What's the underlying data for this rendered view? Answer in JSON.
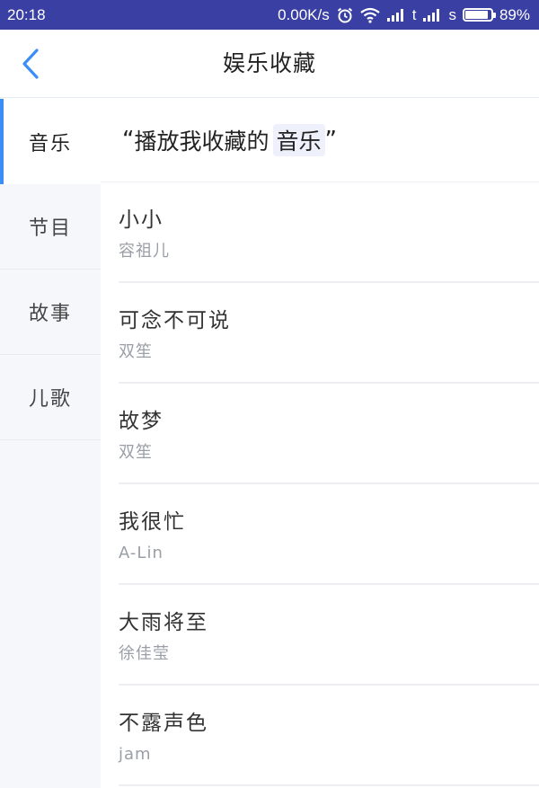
{
  "status_bar": {
    "time": "20:18",
    "speed": "0.00K/s",
    "carrier1": "t",
    "carrier2": "s",
    "battery_level": 0.89,
    "battery_text": "89%"
  },
  "header": {
    "title": "娱乐收藏",
    "back_icon": "chevron-left-icon",
    "accent_color": "#3a8ef6"
  },
  "sidebar": {
    "items": [
      {
        "label": "音乐",
        "active": true
      },
      {
        "label": "节目",
        "active": false
      },
      {
        "label": "故事",
        "active": false
      },
      {
        "label": "儿歌",
        "active": false
      }
    ]
  },
  "phrase": {
    "open_quote": "“",
    "prefix": "播放我收藏的",
    "keyword": "音乐",
    "close_quote": "”"
  },
  "songs": [
    {
      "title": "小小",
      "artist": "容祖儿"
    },
    {
      "title": "可念不可说",
      "artist": "双笙"
    },
    {
      "title": "故梦",
      "artist": "双笙"
    },
    {
      "title": "我很忙",
      "artist": "A-Lin"
    },
    {
      "title": "大雨将至",
      "artist": "徐佳莹"
    },
    {
      "title": "不露声色",
      "artist": "jam"
    }
  ],
  "colors": {
    "status_bar": "#3a3fa3",
    "sidebar_bg": "#f6f7fb",
    "active_indicator": "#3a8ef6"
  }
}
